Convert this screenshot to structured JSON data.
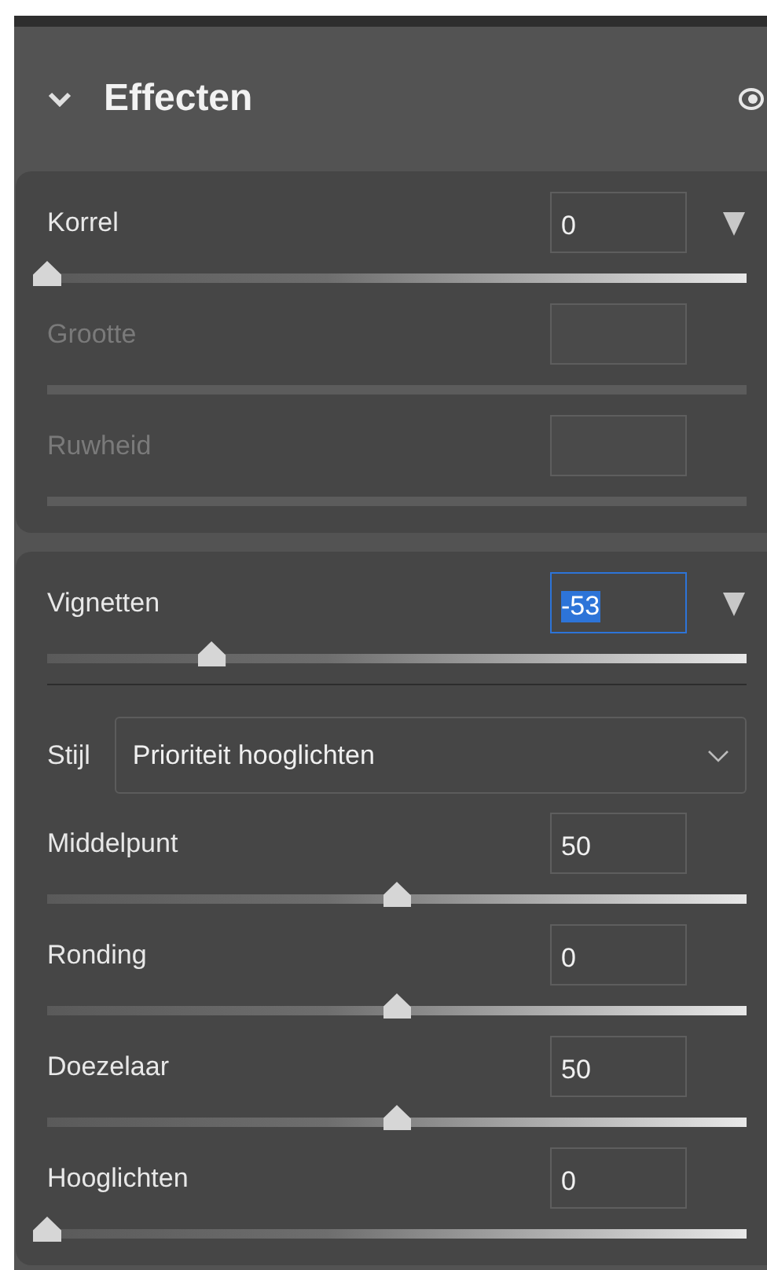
{
  "panel": {
    "title": "Effecten",
    "expanded": true,
    "visible": true
  },
  "groups": [
    {
      "controls": [
        {
          "kind": "menu_slider",
          "label": "Korrel",
          "value": "0",
          "level": 0,
          "disabled": false,
          "focused": false
        },
        {
          "kind": "slider",
          "label": "Grootte",
          "disabled": true,
          "focused": false
        },
        {
          "kind": "slider",
          "label": "Ruwheid",
          "disabled": true,
          "focused": false
        }
      ]
    },
    {
      "controls": [
        {
          "kind": "menu_slider",
          "label": "Vignetten",
          "value": "-53",
          "level": 0.235,
          "disabled": false,
          "focused": true
        },
        {
          "kind": "divider"
        },
        {
          "kind": "select",
          "label": "Stijl",
          "value": "Prioriteit hooglichten"
        },
        {
          "kind": "slider",
          "label": "Middelpunt",
          "value": "50",
          "level": 0.5,
          "disabled": false,
          "focused": false
        },
        {
          "kind": "slider",
          "label": "Ronding",
          "value": "0",
          "level": 0.5,
          "disabled": false,
          "focused": false
        },
        {
          "kind": "slider",
          "label": "Doezelaar",
          "value": "50",
          "level": 0.5,
          "disabled": false,
          "focused": false
        },
        {
          "kind": "slider",
          "label": "Hooglichten",
          "value": "0",
          "level": 0,
          "disabled": false,
          "focused": false
        }
      ]
    }
  ]
}
